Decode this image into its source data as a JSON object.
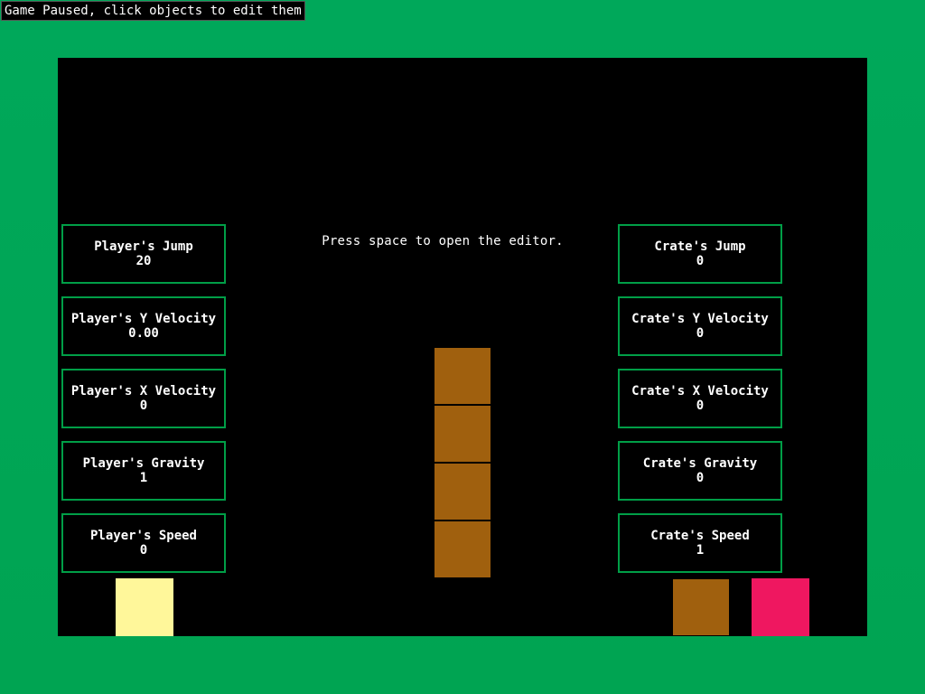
{
  "status": {
    "text": "Game Paused, click objects to edit them"
  },
  "hint": {
    "text": "Press space to open the editor."
  },
  "player_stats": [
    {
      "label": "Player's Jump",
      "value": "20"
    },
    {
      "label": "Player's Y Velocity",
      "value": "0.00"
    },
    {
      "label": "Player's X Velocity",
      "value": "0"
    },
    {
      "label": "Player's Gravity",
      "value": "1"
    },
    {
      "label": "Player's Speed",
      "value": "0"
    }
  ],
  "crate_stats": [
    {
      "label": "Crate's Jump",
      "value": "0"
    },
    {
      "label": "Crate's Y Velocity",
      "value": "0"
    },
    {
      "label": "Crate's X Velocity",
      "value": "0"
    },
    {
      "label": "Crate's Gravity",
      "value": "0"
    },
    {
      "label": "Crate's Speed",
      "value": "1"
    }
  ],
  "colors": {
    "background": "#00a452",
    "stage": "#000000",
    "panel_border": "#009e47",
    "crate": "#a0600e",
    "player": "#fff79a",
    "goal": "#ef1760"
  }
}
